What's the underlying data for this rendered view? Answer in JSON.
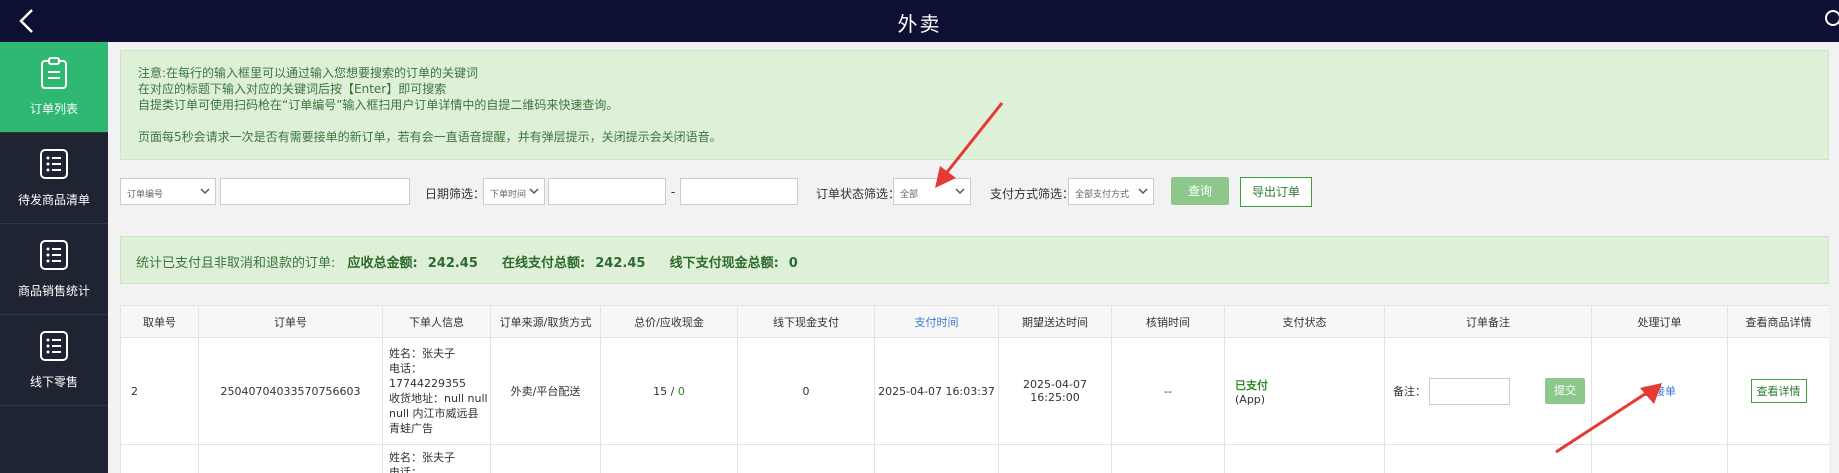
{
  "header": {
    "title": "外卖"
  },
  "sidebar": {
    "items": [
      {
        "label": "订单列表",
        "active": true,
        "icon": "clipboard-icon"
      },
      {
        "label": "待发商品清单",
        "active": false,
        "icon": "list-icon"
      },
      {
        "label": "商品销售统计",
        "active": false,
        "icon": "list-icon"
      },
      {
        "label": "线下零售",
        "active": false,
        "icon": "list-icon"
      }
    ]
  },
  "notice": {
    "lines": [
      "注意:在每行的输入框里可以通过输入您想要搜索的订单的关键词",
      "在对应的标题下输入对应的关键词后按【Enter】即可搜索",
      "自提类订单可使用扫码枪在“订单编号”输入框扫用户订单详情中的自提二维码来快速查询。",
      "页面每5秒会请求一次是否有需要接单的新订单，若有会一直语音提醒，并有弹层提示，关闭提示会关闭语音。"
    ]
  },
  "filters": {
    "order_field_select": "订单编号",
    "date_label": "日期筛选：",
    "date_type_select": "下单时间",
    "date_separator": "-",
    "status_label": "订单状态筛选：",
    "status_select": "全部",
    "payment_label": "支付方式筛选：",
    "payment_select": "全部支付方式",
    "query_button": "查询",
    "export_button": "导出订单"
  },
  "stats": {
    "prefix": "统计已支付且非取消和退款的订单:",
    "receivable_label": "应收总金额:",
    "receivable_value": "242.45",
    "online_label": "在线支付总额:",
    "online_value": "242.45",
    "offline_label": "线下支付现金总额:",
    "offline_value": "0"
  },
  "table": {
    "headers": [
      "取单号",
      "订单号",
      "下单人信息",
      "订单来源/取货方式",
      "总价/应收现金",
      "线下现金支付",
      "支付时间",
      "期望送达时间",
      "核销时间",
      "支付状态",
      "订单备注",
      "处理订单",
      "查看商品详情"
    ],
    "rows": [
      {
        "pickup_no": "2",
        "order_no": "25040704033570756603",
        "customer": {
          "name": "姓名：张夫子",
          "phone_label": "电话：",
          "phone": "17744229355",
          "address": "收货地址：null null null 内江市威远县 青蛙广告"
        },
        "source": "外卖/平台配送",
        "total": "15",
        "total_sep": " / ",
        "cash_due": "0",
        "offline_cash": "0",
        "pay_time": "2025-04-07 16:03:37",
        "expected_delivery": "2025-04-07 16:25:00",
        "verify_time": "--",
        "pay_status": "已支付",
        "pay_channel": "(App)",
        "remark_label": "备注：",
        "submit_button": "提交",
        "process_action": "已接单",
        "detail_button": "查看详情"
      },
      {
        "customer": {
          "name": "姓名：张夫子",
          "phone_label": "电话："
        }
      }
    ]
  },
  "colors": {
    "topbar": "#0d0f33",
    "sidebar": "#1f2433",
    "sidebar_active": "#2eb872",
    "notice_bg": "#dff0d8",
    "notice_text": "#3c763d",
    "link_blue": "#3a7bd5",
    "annotation_red": "#e53935"
  }
}
